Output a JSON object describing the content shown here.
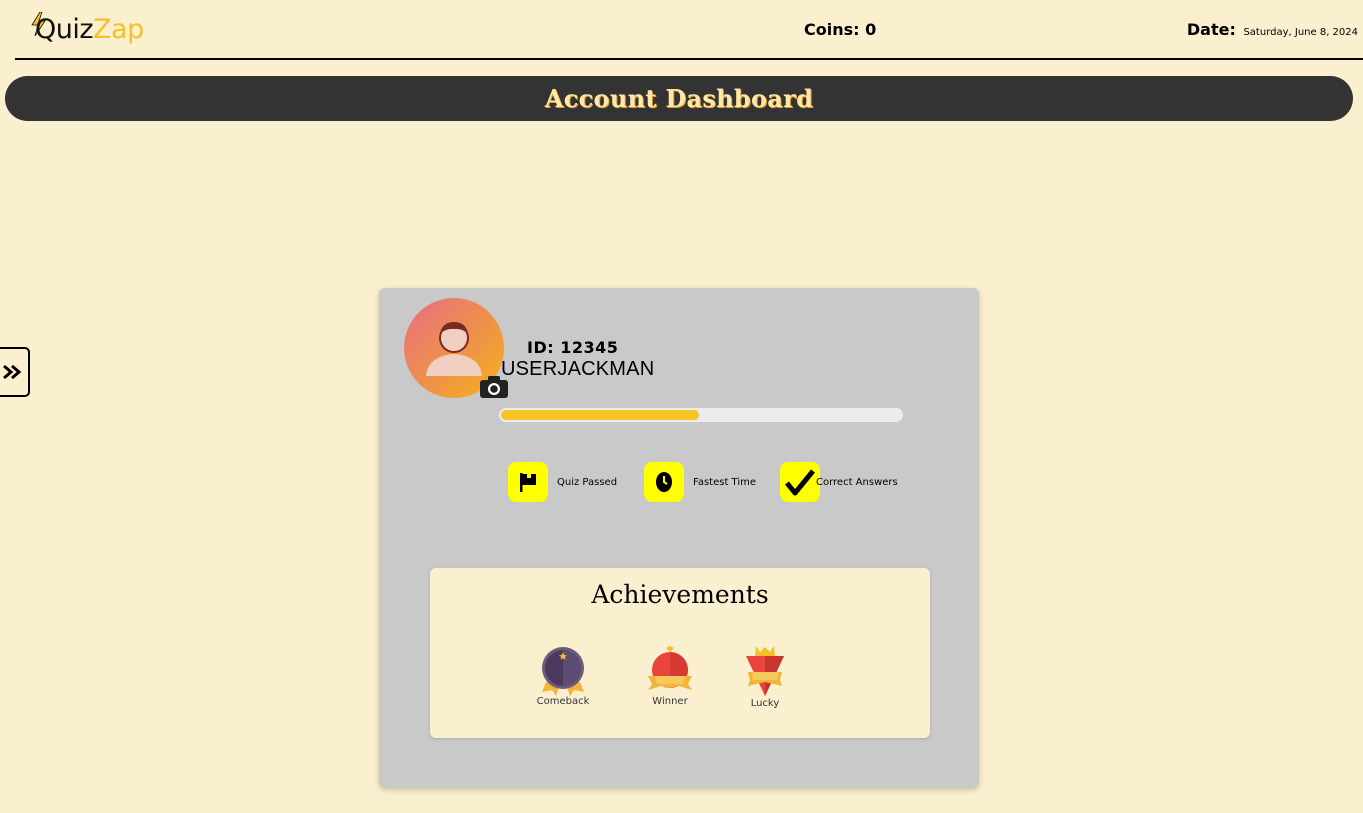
{
  "header": {
    "logo_part1": "Quiz",
    "logo_part2": "Zap",
    "coins_text": "Coins: 0",
    "date_label": "Date:",
    "date_value": "Saturday, June 8, 2024"
  },
  "banner": {
    "title": "Account Dashboard"
  },
  "profile": {
    "id_text": "ID: 12345",
    "username": "USERJACKMAN",
    "progress_fraction": 0.5
  },
  "stats": [
    {
      "label": "Quiz Passed",
      "icon": "flag-icon"
    },
    {
      "label": "Fastest Time",
      "icon": "clock-icon"
    },
    {
      "label": "Correct Answers",
      "icon": "checkmark-icon"
    }
  ],
  "achievements": {
    "title": "Achievements",
    "badges": [
      {
        "label": "Comeback",
        "icon": "comeback-medal-icon"
      },
      {
        "label": "Winner",
        "icon": "winner-medal-icon"
      },
      {
        "label": "Lucky",
        "icon": "lucky-medal-icon"
      }
    ]
  },
  "colors": {
    "background": "#faefcf",
    "banner": "#333333",
    "banner_text": "#ffe7a8",
    "accent": "#f4c12a",
    "stat_icon_bg": "#ffff00",
    "card": "#c9c9c9"
  }
}
